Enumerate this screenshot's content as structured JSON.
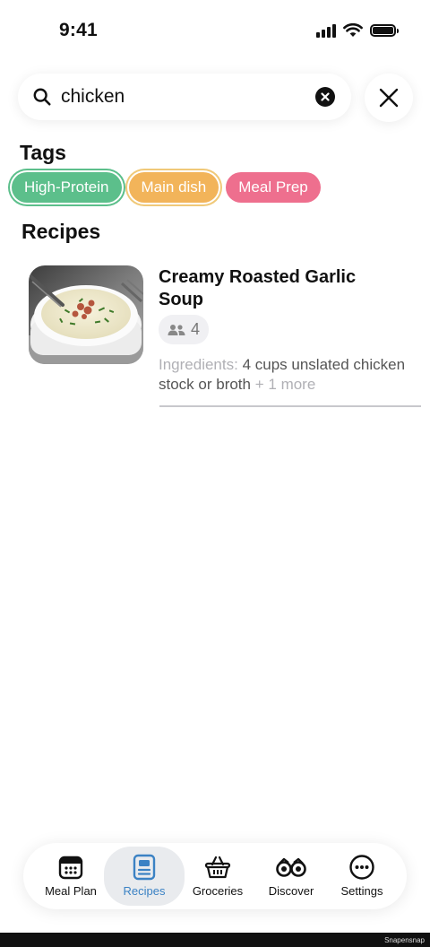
{
  "status": {
    "time": "9:41"
  },
  "search": {
    "value": "chicken"
  },
  "sections": {
    "tags": "Tags",
    "recipes": "Recipes"
  },
  "tags": [
    {
      "label": "High-Protein",
      "color": "#5cbf8b"
    },
    {
      "label": "Main dish",
      "color": "#f2b45a"
    },
    {
      "label": "Meal Prep",
      "color": "#ee6f8e"
    }
  ],
  "recipe": {
    "title": "Creamy Roasted Garlic Soup",
    "servings": "4",
    "ingredients_label": "Ingredients:",
    "ingredients_value": "4 cups unslated chicken stock or broth",
    "more": "+ 1 more"
  },
  "tabbar": {
    "items": [
      {
        "label": "Meal Plan",
        "icon": "calendar-icon"
      },
      {
        "label": "Recipes",
        "icon": "recipe-book-icon",
        "active": true
      },
      {
        "label": "Groceries",
        "icon": "basket-icon"
      },
      {
        "label": "Discover",
        "icon": "binoculars-icon"
      },
      {
        "label": "Settings",
        "icon": "more-icon"
      }
    ]
  },
  "colors": {
    "accent": "#3b82c4"
  },
  "watermark": "Snapensnap"
}
